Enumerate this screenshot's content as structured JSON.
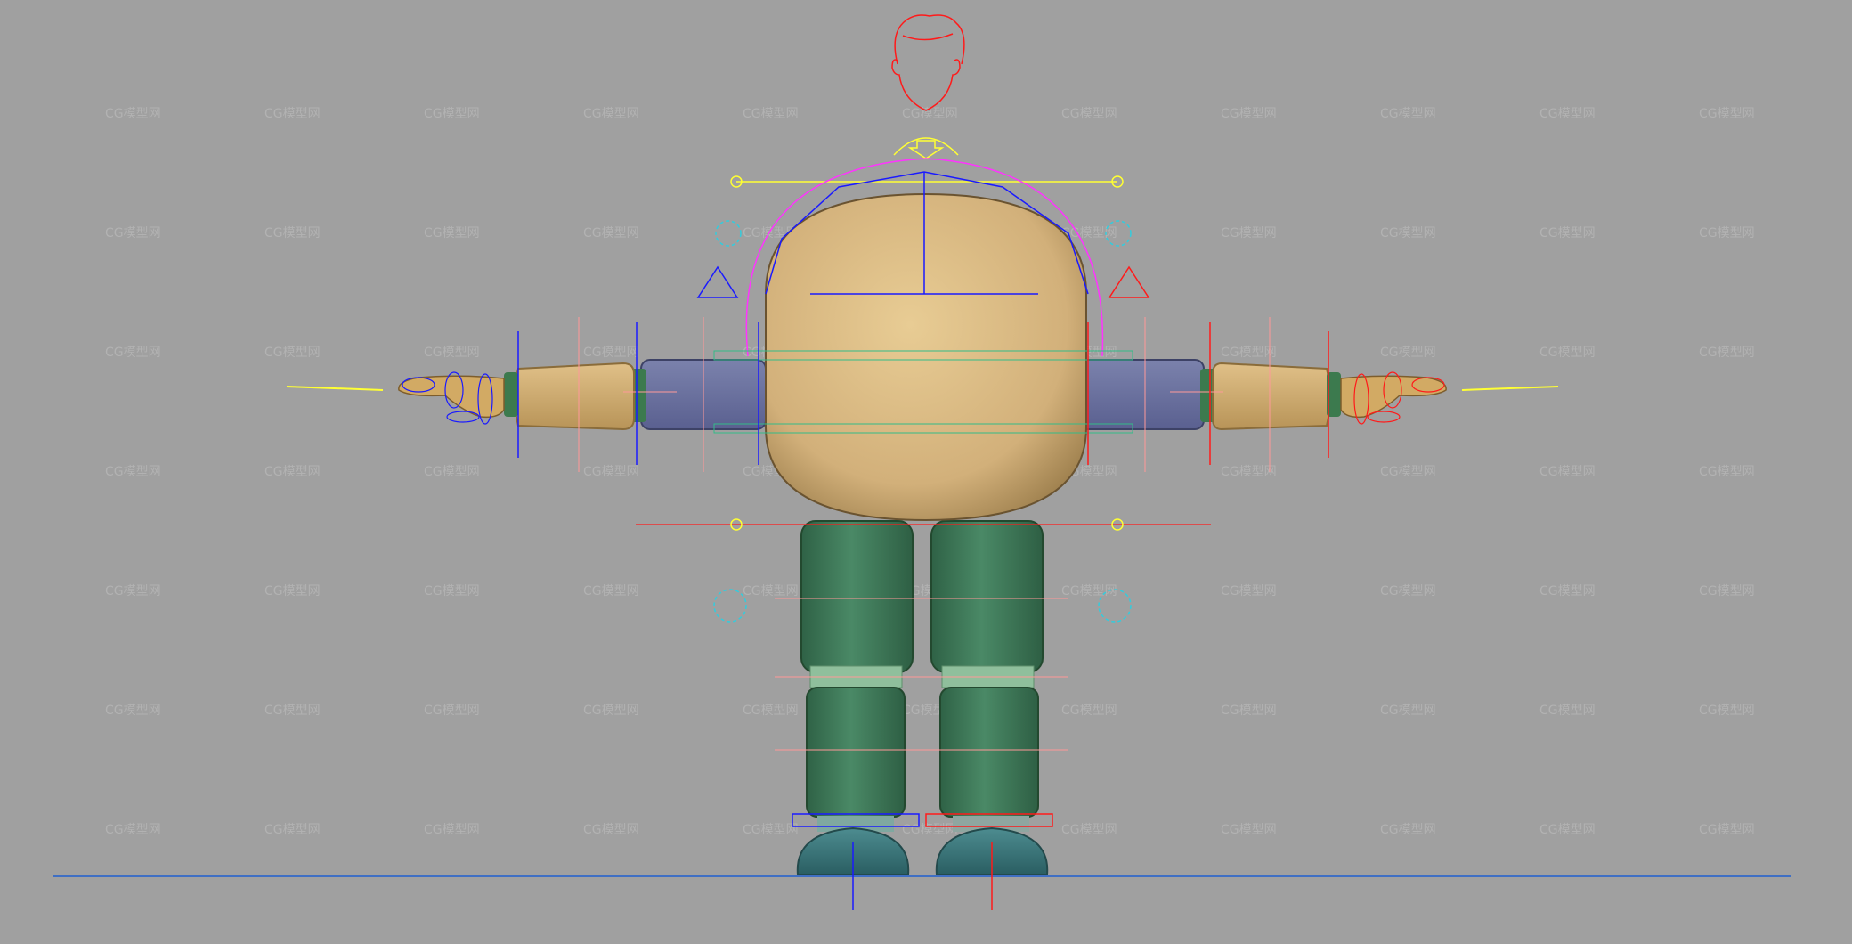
{
  "viewport": {
    "background": "#a0a0a0",
    "watermark_text": "CG模型网",
    "watermark_rows": 7,
    "watermark_cols": 11
  },
  "colors": {
    "skin": "#d8b478",
    "skin_dark": "#b08a4e",
    "shirt_sleeve": "#6e75a0",
    "pants": "#3f7a5c",
    "pants_light": "#8fbf9c",
    "shoes": "#3c7a80",
    "ctrl_blue": "#1a1aff",
    "ctrl_red": "#ff1a1a",
    "ctrl_yellow": "#ffff33",
    "ctrl_magenta": "#ff33ff",
    "ctrl_cyan": "#33ccdd",
    "ctrl_pink": "#ff9999",
    "ground_line": "#1f5fd0"
  },
  "icons": {
    "head_control": "face-outline-icon",
    "root_control": "arrow-down-icon",
    "ik_left": "triangle-icon",
    "ik_right": "triangle-icon",
    "pole_vector": "gear-outline-icon"
  }
}
